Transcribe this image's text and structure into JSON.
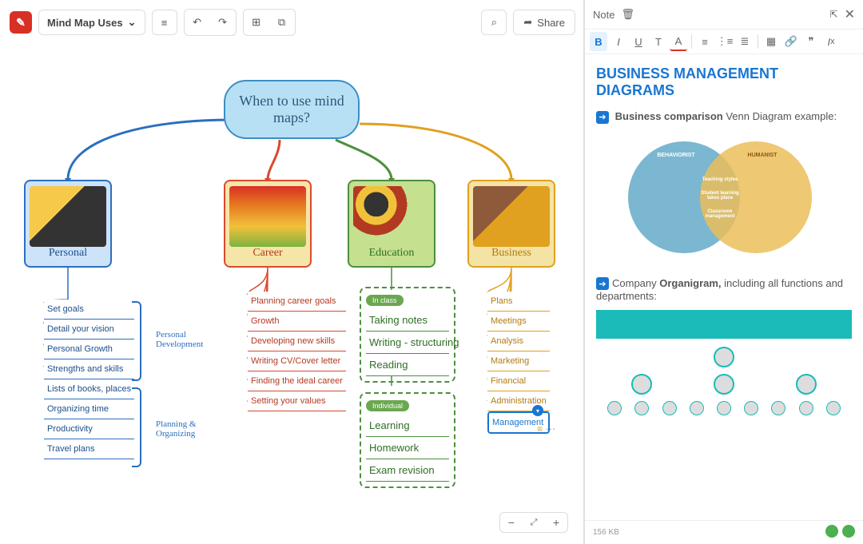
{
  "header": {
    "title": "Mind Map Uses",
    "share_label": "Share"
  },
  "mindmap": {
    "central": "When to use mind maps?",
    "branches": {
      "personal": {
        "label": "Personal",
        "groups": [
          {
            "annotation": "Personal Development",
            "items": [
              "Set goals",
              "Detail your vision",
              "Personal Growth",
              "Strengths and skills"
            ]
          },
          {
            "annotation": "Planning & Organizing",
            "items": [
              "Lists of books, places",
              "Organizing time",
              "Productivity",
              "Travel plans"
            ]
          }
        ]
      },
      "career": {
        "label": "Career",
        "items": [
          "Planning career goals",
          "Growth",
          "Developing new skills",
          "Writing CV/Cover letter",
          "Finding the ideal career",
          "Setting  your values"
        ]
      },
      "education": {
        "label": "Education",
        "groups": [
          {
            "tag": "In class",
            "items": [
              "Taking notes",
              "Writing - structuring",
              "Reading"
            ]
          },
          {
            "tag": "Individual",
            "items": [
              "Learning",
              "Homework",
              "Exam revision"
            ]
          }
        ]
      },
      "business": {
        "label": "Business",
        "items": [
          "Plans",
          "Meetings",
          "Analysis",
          "Marketing",
          "Financial",
          "Administration",
          "Management"
        ],
        "selected": "Management"
      }
    }
  },
  "note": {
    "panel_title": "Note",
    "heading": "BUSINESS MANAGEMENT DIAGRAMS",
    "line1_bold": "Business comparison",
    "line1_rest": " Venn Diagram example:",
    "venn": {
      "left_label": "BEHAVIORIST",
      "right_label": "HUMANIST",
      "center_lines": [
        "Teaching styles",
        "Student learning takes place",
        "Classroom management"
      ]
    },
    "line2_pre": "Company ",
    "line2_bold": "Organigram,",
    "line2_rest": " including all functions and departments:",
    "footer_size": "156 KB"
  }
}
